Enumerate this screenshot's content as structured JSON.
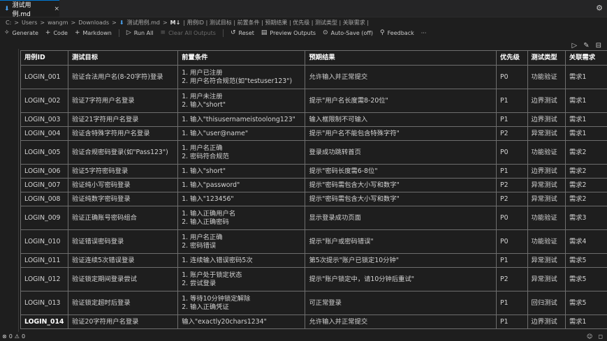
{
  "tab": {
    "title": "测试用例.md",
    "file_icon": "⬇",
    "close": "×"
  },
  "breadcrumb": {
    "drive": "C:",
    "p1": "Users",
    "p2": "wangm",
    "p3": "Downloads",
    "file": "测试用例.md",
    "nb": "M↓",
    "rest": "| 用例ID | 测试目标 | 前置条件 | 预期结果 | 优先级 | 测试类型 | 关联需求 |"
  },
  "toolbar": {
    "generate": "Generate",
    "code": "Code",
    "markdown": "Markdown",
    "run_all": "Run All",
    "clear_outputs": "Clear All Outputs",
    "reset": "Reset",
    "preview_outputs": "Preview Outputs",
    "auto_save": "Auto-Save (off)",
    "feedback": "Feedback",
    "more": "···"
  },
  "table": {
    "headers": [
      "用例ID",
      "测试目标",
      "前置条件",
      "预期结果",
      "优先级",
      "测试类型",
      "关联需求"
    ],
    "rows": [
      {
        "id": "LOGIN_001",
        "target": "验证合法用户名(8-20字符)登录",
        "pre": [
          "1. 用户已注册",
          "2. 用户名符合规范(如\"testuser123\")"
        ],
        "expect": "允许输入并正常提交",
        "pri": "P0",
        "type": "功能验证",
        "req": "需求1"
      },
      {
        "id": "LOGIN_002",
        "target": "验证7字符用户名登录",
        "pre": [
          "1. 用户未注册",
          "2. 输入\"short\""
        ],
        "expect": "提示\"用户名长度需8-20位\"",
        "pri": "P1",
        "type": "边界测试",
        "req": "需求1"
      },
      {
        "id": "LOGIN_003",
        "target": "验证21字符用户名登录",
        "pre": [
          "1. 输入\"thisusernameistoolong123\""
        ],
        "expect": "输入框限制不可输入",
        "pri": "P1",
        "type": "边界测试",
        "req": "需求1"
      },
      {
        "id": "LOGIN_004",
        "target": "验证含特殊字符用户名登录",
        "pre": [
          "1. 输入\"user@name\""
        ],
        "expect": "提示\"用户名不能包含特殊字符\"",
        "pri": "P2",
        "type": "异常测试",
        "req": "需求1"
      },
      {
        "id": "LOGIN_005",
        "target": "验证合规密码登录(如\"Pass123\")",
        "pre": [
          "1. 用户名正确",
          "2. 密码符合规范"
        ],
        "expect": "登录成功跳转首页",
        "pri": "P0",
        "type": "功能验证",
        "req": "需求2"
      },
      {
        "id": "LOGIN_006",
        "target": "验证5字符密码登录",
        "pre": [
          "1. 输入\"short\""
        ],
        "expect": "提示\"密码长度需6-8位\"",
        "pri": "P1",
        "type": "边界测试",
        "req": "需求2"
      },
      {
        "id": "LOGIN_007",
        "target": "验证纯小写密码登录",
        "pre": [
          "1. 输入\"password\""
        ],
        "expect": "提示\"密码需包含大小写和数字\"",
        "pri": "P2",
        "type": "异常测试",
        "req": "需求2"
      },
      {
        "id": "LOGIN_008",
        "target": "验证纯数字密码登录",
        "pre": [
          "1. 输入\"123456\""
        ],
        "expect": "提示\"密码需包含大小写和数字\"",
        "pri": "P2",
        "type": "异常测试",
        "req": "需求2"
      },
      {
        "id": "LOGIN_009",
        "target": "验证正确账号密码组合",
        "pre": [
          "1. 输入正确用户名",
          "2. 输入正确密码"
        ],
        "expect": "显示登录成功页面",
        "pri": "P0",
        "type": "功能验证",
        "req": "需求3"
      },
      {
        "id": "LOGIN_010",
        "target": "验证错误密码登录",
        "pre": [
          "1. 用户名正确",
          "2. 密码错误"
        ],
        "expect": "提示\"账户或密码错误\"",
        "pri": "P0",
        "type": "功能验证",
        "req": "需求4"
      },
      {
        "id": "LOGIN_011",
        "target": "验证连续5次错误登录",
        "pre": [
          "1. 连续输入错误密码5次"
        ],
        "expect": "第5次提示\"账户已锁定10分钟\"",
        "pri": "P1",
        "type": "异常测试",
        "req": "需求5"
      },
      {
        "id": "LOGIN_012",
        "target": "验证锁定期间登录尝试",
        "pre": [
          "1. 账户处于锁定状态",
          "2. 尝试登录"
        ],
        "expect": "提示\"账户锁定中，请10分钟后重试\"",
        "pri": "P2",
        "type": "异常测试",
        "req": "需求5"
      },
      {
        "id": "LOGIN_013",
        "target": "验证锁定超时后登录",
        "pre": [
          "1. 等待10分钟锁定解除",
          "2. 输入正确凭证"
        ],
        "expect": "可正常登录",
        "pri": "P1",
        "type": "回归测试",
        "req": "需求5"
      },
      {
        "id": "LOGIN_014",
        "target": "验证20字符用户名登录",
        "pre": [
          "输入\"exactly20chars1234\""
        ],
        "expect": "允许输入并正常提交",
        "pri": "P1",
        "type": "边界测试",
        "req": "需求1"
      }
    ]
  },
  "status": {
    "errors": "0",
    "warnings": "0"
  },
  "icons": {
    "gear": "⚙",
    "generate": "✧",
    "code": "+",
    "markdown": "+",
    "run": "▷",
    "clear": "≡",
    "reset": "↺",
    "preview": "▤",
    "autosave": "⊙",
    "feedback": "⚲",
    "cell_run": "▷",
    "cell_edit": "✎",
    "cell_split": "⊟"
  }
}
